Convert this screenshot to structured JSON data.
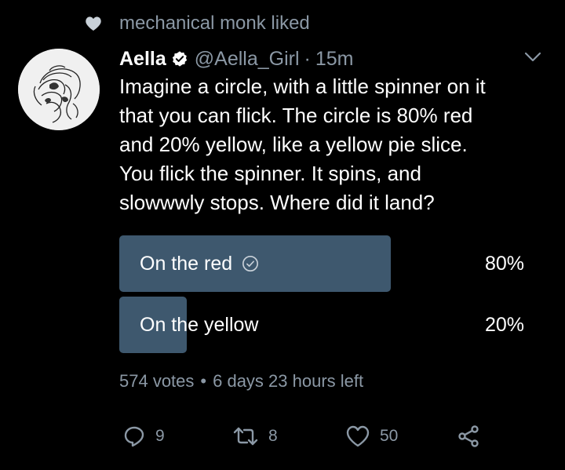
{
  "liked_by": {
    "text": "mechanical monk liked",
    "icon": "heart-icon"
  },
  "tweet": {
    "author_name": "Aella",
    "verified": true,
    "handle": "@Aella_Girl",
    "separator": "·",
    "time_ago": "15m",
    "text_lines": [
      "Imagine a circle, with a little spinner on it",
      "that you can flick. The circle is 80% red",
      "and 20% yellow, like a yellow pie slice.",
      "You flick the spinner. It spins, and",
      "slowwwly stops. Where did it land?"
    ]
  },
  "poll": {
    "options": [
      {
        "label": "On the red",
        "percent_text": "80%",
        "percent": 80,
        "selected": true
      },
      {
        "label": "On the yellow",
        "percent_text": "20%",
        "percent": 20,
        "selected": false
      }
    ],
    "votes": "574 votes",
    "bullet": "•",
    "time_left": "6 days 23 hours left"
  },
  "actions": {
    "reply": {
      "icon": "reply-icon",
      "count": "9"
    },
    "retweet": {
      "icon": "retweet-icon",
      "count": "8"
    },
    "like": {
      "icon": "like-icon",
      "count": "50"
    },
    "share": {
      "icon": "share-icon"
    }
  },
  "colors": {
    "background": "#000000",
    "text": "#ffffff",
    "muted": "#8b98a5",
    "poll_bar": "#3e586e",
    "verified_badge": "#ffffff"
  }
}
